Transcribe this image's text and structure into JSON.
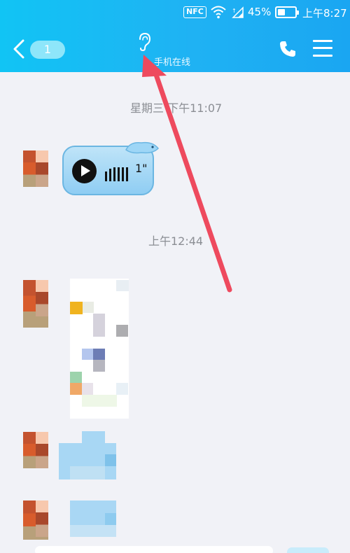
{
  "status_bar": {
    "nfc": "NFC",
    "battery_percent": "45%",
    "battery_level": 0.45,
    "time": "上午8:27"
  },
  "header": {
    "unread_count": "1",
    "contact_status": "手机在线",
    "background": "#1fb2f3",
    "icons": [
      "back-chevron-icon",
      "ear-icon",
      "phone-icon",
      "menu-icon"
    ]
  },
  "chat": {
    "timestamps": [
      "星期三 下午11:07",
      "上午12:44"
    ],
    "voice_message": {
      "duration": "1\""
    }
  },
  "annotation": {
    "arrow_color": "#ee4a5e"
  }
}
